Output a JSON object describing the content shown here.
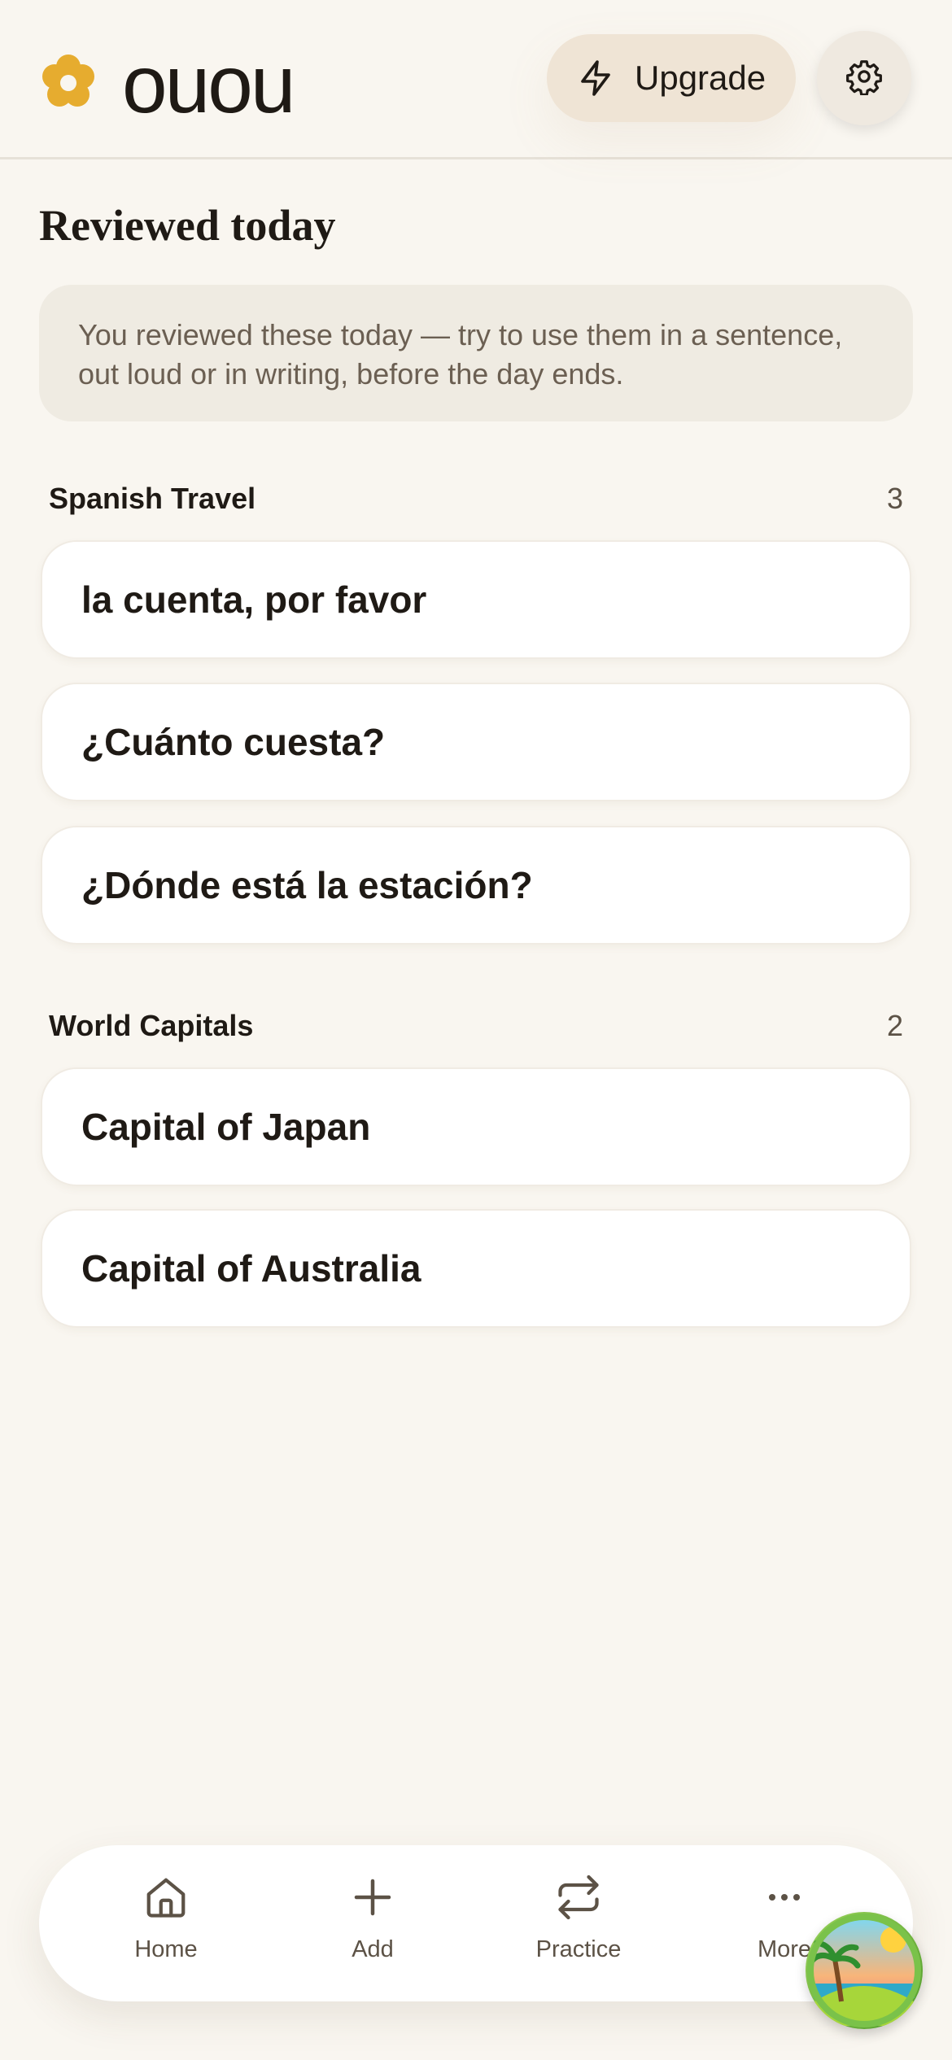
{
  "header": {
    "brand": "ouou",
    "upgrade_label": "Upgrade",
    "colors": {
      "logo": "#e6ac2f",
      "upgrade_bg": "#efe4d5"
    }
  },
  "main": {
    "title": "Reviewed today",
    "tip": "You reviewed these today — try to use them in a sentence, out loud or in writing, before the day ends.",
    "decks": [
      {
        "name": "Spanish Travel",
        "count": "3",
        "cards": [
          "la cuenta, por favor",
          "¿Cuánto cuesta?",
          "¿Dónde está la estación?"
        ]
      },
      {
        "name": "World Capitals",
        "count": "2",
        "cards": [
          "Capital of Japan",
          "Capital of Australia"
        ]
      }
    ]
  },
  "nav": {
    "items": [
      {
        "label": "Home",
        "icon": "home-icon"
      },
      {
        "label": "Add",
        "icon": "plus-icon"
      },
      {
        "label": "Practice",
        "icon": "repeat-icon"
      },
      {
        "label": "More",
        "icon": "more-icon"
      }
    ]
  },
  "icons": {
    "logo": "flower-icon",
    "upgrade": "lightning-icon",
    "settings": "gear-icon",
    "avatar": "beach-avatar"
  }
}
